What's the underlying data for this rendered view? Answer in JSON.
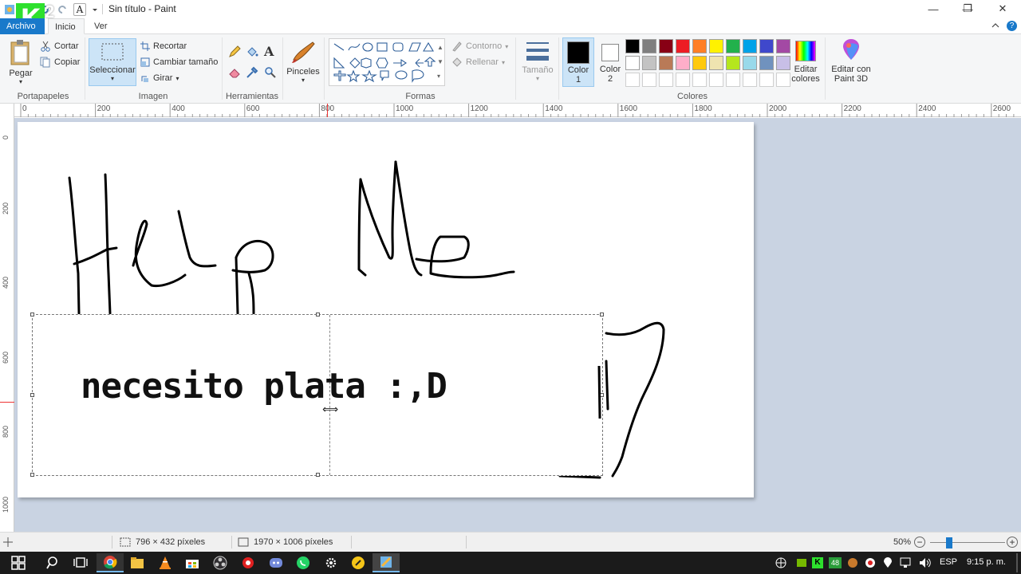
{
  "window": {
    "title": "Sin título - Paint",
    "minimize": "—",
    "restore": "❐",
    "close": "✕"
  },
  "logo": {
    "text": "K",
    "superscript": "2"
  },
  "tabs": {
    "file": "Archivo",
    "home": "Inicio",
    "view": "Ver"
  },
  "ribbon": {
    "clipboard": {
      "paste": "Pegar",
      "cut": "Cortar",
      "copy": "Copiar",
      "label": "Portapapeles"
    },
    "image": {
      "select": "Seleccionar",
      "crop": "Recortar",
      "resize": "Cambiar tamaño",
      "rotate": "Girar",
      "label": "Imagen"
    },
    "tools": {
      "label": "Herramientas"
    },
    "brushes": {
      "label": "Pinceles"
    },
    "shapes": {
      "outline": "Contorno",
      "fill": "Rellenar",
      "label": "Formas"
    },
    "size": {
      "label": "Tamaño"
    },
    "colors": {
      "color1": "Color",
      "color1_num": "1",
      "color2": "Color",
      "color2_num": "2",
      "edit_colors_1": "Editar",
      "edit_colors_2": "colores",
      "paint3d_1": "Editar con",
      "paint3d_2": "Paint 3D",
      "label": "Colores",
      "color1_value": "#000000",
      "color2_value": "#ffffff",
      "palette": [
        "#000000",
        "#7f7f7f",
        "#880015",
        "#ed1c24",
        "#ff7f27",
        "#fff200",
        "#22b14c",
        "#00a2e8",
        "#3f48cc",
        "#a349a4",
        "#ffffff",
        "#c3c3c3",
        "#b97a57",
        "#ffaec9",
        "#ffc90e",
        "#efe4b0",
        "#b5e61d",
        "#99d9ea",
        "#7092be",
        "#c8bfe7",
        "#ffffff",
        "#ffffff",
        "#ffffff",
        "#ffffff",
        "#ffffff",
        "#ffffff",
        "#ffffff",
        "#ffffff",
        "#ffffff",
        "#ffffff"
      ]
    }
  },
  "ruler": {
    "top": [
      "0",
      "200",
      "400",
      "600",
      "800",
      "1000",
      "1200",
      "1400",
      "1600",
      "1800",
      "2000",
      "2200",
      "2400",
      "2600"
    ],
    "left": [
      "0",
      "200",
      "400",
      "600",
      "800",
      "1000"
    ]
  },
  "canvas": {
    "text": "necesito plata :,D"
  },
  "status": {
    "selection": "796 × 432 píxeles",
    "image_size": "1970 × 1006 píxeles",
    "zoom": "50%"
  },
  "taskbar": {
    "lang": "ESP",
    "time": "9:15 p. m.",
    "badge": "48"
  }
}
